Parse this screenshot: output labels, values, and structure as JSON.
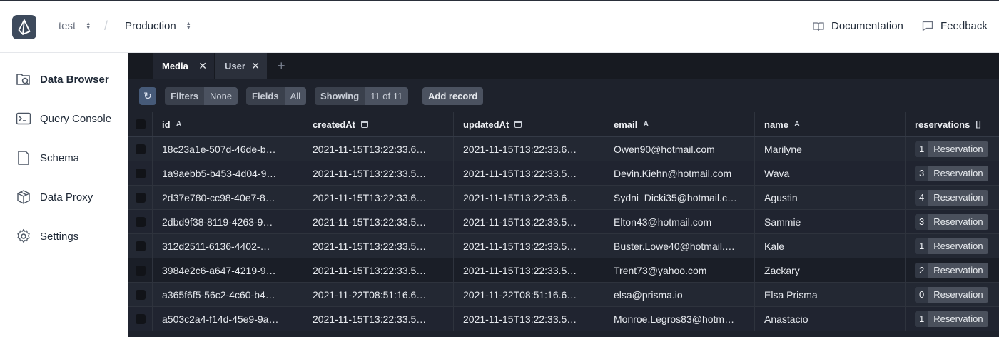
{
  "header": {
    "project": "test",
    "environment": "Production",
    "documentation": "Documentation",
    "feedback": "Feedback"
  },
  "sidebar": {
    "items": [
      {
        "label": "Data Browser",
        "icon": "data-browser-icon"
      },
      {
        "label": "Query Console",
        "icon": "console-icon"
      },
      {
        "label": "Schema",
        "icon": "schema-icon"
      },
      {
        "label": "Data Proxy",
        "icon": "cube-icon"
      },
      {
        "label": "Settings",
        "icon": "gear-icon"
      }
    ]
  },
  "tabs": [
    {
      "label": "Media"
    },
    {
      "label": "User"
    }
  ],
  "toolbar": {
    "filters_label": "Filters",
    "filters_value": "None",
    "fields_label": "Fields",
    "fields_value": "All",
    "showing_label": "Showing",
    "showing_value": "11 of 11",
    "add_record": "Add record"
  },
  "table": {
    "columns": [
      {
        "label": "id",
        "type_glyph": "A"
      },
      {
        "label": "createdAt",
        "type_glyph": "calendar"
      },
      {
        "label": "updatedAt",
        "type_glyph": "calendar"
      },
      {
        "label": "email",
        "type_glyph": "A"
      },
      {
        "label": "name",
        "type_glyph": "A"
      },
      {
        "label": "reservations",
        "type_glyph": "[]"
      }
    ],
    "rows": [
      {
        "id": "18c23a1e-507d-46de-b…",
        "createdAt": "2021-11-15T13:22:33.6…",
        "updatedAt": "2021-11-15T13:22:33.6…",
        "email": "Owen90@hotmail.com",
        "name": "Marilyne",
        "res_count": "1",
        "res_label": "Reservation"
      },
      {
        "id": "1a9aebb5-b453-4d04-9…",
        "createdAt": "2021-11-15T13:22:33.5…",
        "updatedAt": "2021-11-15T13:22:33.5…",
        "email": "Devin.Kiehn@hotmail.com",
        "name": "Wava",
        "res_count": "3",
        "res_label": "Reservation"
      },
      {
        "id": "2d37e780-cc98-40e7-8…",
        "createdAt": "2021-11-15T13:22:33.6…",
        "updatedAt": "2021-11-15T13:22:33.6…",
        "email": "Sydni_Dicki35@hotmail.c…",
        "name": "Agustin",
        "res_count": "4",
        "res_label": "Reservation"
      },
      {
        "id": "2dbd9f38-8119-4263-9…",
        "createdAt": "2021-11-15T13:22:33.5…",
        "updatedAt": "2021-11-15T13:22:33.5…",
        "email": "Elton43@hotmail.com",
        "name": "Sammie",
        "res_count": "3",
        "res_label": "Reservation"
      },
      {
        "id": "312d2511-6136-4402-…",
        "createdAt": "2021-11-15T13:22:33.5…",
        "updatedAt": "2021-11-15T13:22:33.5…",
        "email": "Buster.Lowe40@hotmail.…",
        "name": "Kale",
        "res_count": "1",
        "res_label": "Reservation"
      },
      {
        "id": "3984e2c6-a647-4219-9…",
        "createdAt": "2021-11-15T13:22:33.5…",
        "updatedAt": "2021-11-15T13:22:33.5…",
        "email": "Trent73@yahoo.com",
        "name": "Zackary",
        "res_count": "2",
        "res_label": "Reservation"
      },
      {
        "id": "a365f6f5-56c2-4c60-b4…",
        "createdAt": "2021-11-22T08:51:16.6…",
        "updatedAt": "2021-11-22T08:51:16.6…",
        "email": "elsa@prisma.io",
        "name": "Elsa Prisma",
        "res_count": "0",
        "res_label": "Reservation"
      },
      {
        "id": "a503c2a4-f14d-45e9-9a…",
        "createdAt": "2021-11-15T13:22:33.5…",
        "updatedAt": "2021-11-15T13:22:33.5…",
        "email": "Monroe.Legros83@hotm…",
        "name": "Anastacio",
        "res_count": "1",
        "res_label": "Reservation"
      }
    ]
  }
}
